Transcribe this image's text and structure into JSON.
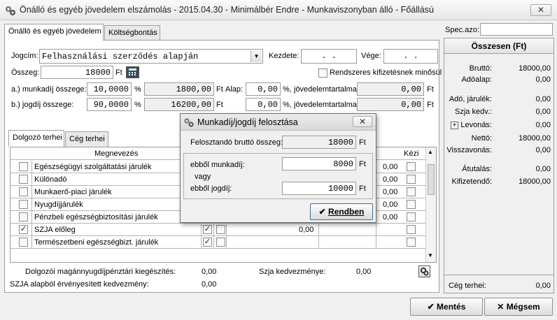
{
  "window": {
    "title": "Önálló és egyéb jövedelem elszámolás - 2015.04.30 - Minimálbér Endre - Munkaviszonyban álló - Főállású",
    "close": "✕"
  },
  "tabs": {
    "main": "Önálló és egyéb jövedelem",
    "cost": "Költségbontás"
  },
  "spec": {
    "label": "Spec.azo:",
    "value": ""
  },
  "form": {
    "jogcim_label": "Jogcím:",
    "jogcim_value": "Felhasználási szerződés alapján",
    "kezdete_label": "Kezdete:",
    "kezdete_value": ". .",
    "vege_label": "Vége:",
    "vege_value": ". .",
    "osszeg_label": "Összeg:",
    "osszeg_value": "18000",
    "ft": "Ft",
    "rendszeres_label": "Rendszeres kifizetésnek minősül",
    "a_label": "a.) munkadíj összege:",
    "a_pct": "10,0000",
    "pct": "%",
    "a_amount": "1800,00",
    "alap_label": "Alap:",
    "a_alap": "0,00",
    "pct2": "%,",
    "jovedelem_label": "jövedelemtartalma:",
    "a_jov": "0,00",
    "b_label": "b.) jogdíj összege:",
    "b_pct": "90,0000",
    "b_amount": "16200,00",
    "b_alap": "0,00",
    "b_jov": "0,00"
  },
  "subtabs": {
    "dolgozo": "Dolgozó terhei",
    "ceg": "Cég terhei"
  },
  "grid": {
    "col_megnevezes": "Megnevezés",
    "col_kezi": "Kézi",
    "rows": [
      {
        "name": "Egészségügyi szolgáltatási járulék",
        "value": "0,00",
        "checked": false
      },
      {
        "name": "Különadó",
        "value": "0,00",
        "checked": false
      },
      {
        "name": "Munkaerő-piaci járulék",
        "value": "0,00",
        "checked": false
      },
      {
        "name": "Nyugdíjjárulék",
        "value": "0,00",
        "checked": false
      },
      {
        "name": "Pénzbeli egészségbiztosítási járulék",
        "value": "0,00",
        "checked": false
      },
      {
        "name": "SZJA előleg",
        "value": "0,00",
        "checked": true
      },
      {
        "name": "Természetbeni egészségbizt. járulék",
        "value": "",
        "checked": false
      }
    ]
  },
  "bottom": {
    "magan_label": "Dolgozói magánnyugdíjpénztári kiegészítés:",
    "magan_value": "0,00",
    "szja_label": "SZJA alapból érvényesített kedvezmény:",
    "szja_value": "0,00",
    "kedv_label": "Szja kedvezménye:",
    "kedv_value": "0,00"
  },
  "summary": {
    "header": "Összesen (Ft)",
    "brutto_label": "Bruttó:",
    "brutto": "18000,00",
    "adoalap_label": "Adóalap:",
    "adoalap": "0,00",
    "ado_label": "Adó, járulék:",
    "ado": "0,00",
    "szja_label": "Szja kedv.:",
    "szja": "0,00",
    "levonas_label": "Levonás:",
    "levonas": "0,00",
    "netto_label": "Nettó:",
    "netto": "18000,00",
    "visszavonas_label": "Visszavonás:",
    "visszavonas": "0,00",
    "atutalas_label": "Átutalás:",
    "atutalas": "0,00",
    "kifizetendo_label": "Kifizetendő:",
    "kifizetendo": "18000,00",
    "ceg_label": "Cég terhei:",
    "ceg": "0,00"
  },
  "dialog": {
    "title": "Munkadíj/jogdíj felosztása",
    "brutto_label": "Felosztandó bruttó összeg:",
    "brutto_value": "18000",
    "munkadij_label": "ebből munkadíj:",
    "munkadij_value": "8000",
    "vagy": "vagy",
    "jogdij_label": "ebből jogdíj:",
    "jogdij_value": "10000",
    "ft": "Ft",
    "ok": "Rendben"
  },
  "buttons": {
    "mentes": "Mentés",
    "megsem": "Mégsem"
  }
}
